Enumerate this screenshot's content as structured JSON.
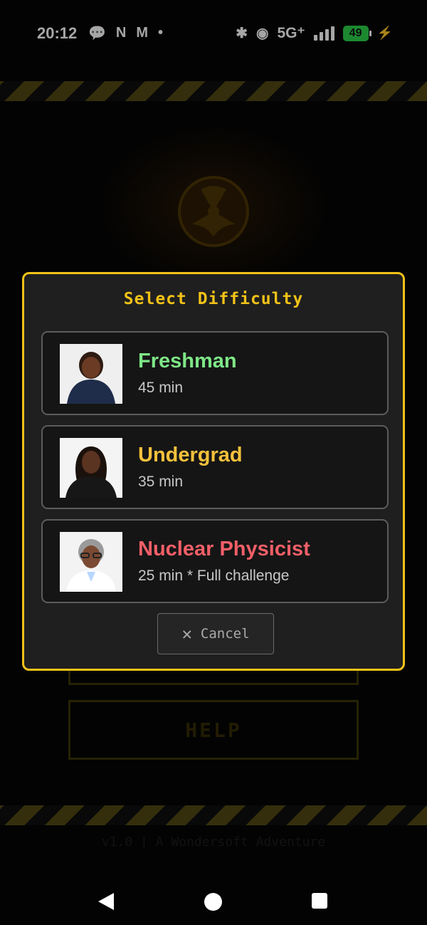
{
  "status": {
    "time": "20:12",
    "network": "5G⁺",
    "battery": "49",
    "left_icons": [
      "chat-icon",
      "n-app-icon",
      "gmail-icon",
      "dot-icon"
    ],
    "right_icons": [
      "bluetooth-icon",
      "hotspot-icon",
      "signal-icon",
      "battery-icon",
      "charging-icon"
    ]
  },
  "background": {
    "help_label": "HELP",
    "footer": "v1.0 | A Wondersoft Adventure",
    "accent_color": "#f2c218"
  },
  "modal": {
    "title": "Select Difficulty",
    "options": [
      {
        "title": "Freshman",
        "subtitle": "45 min",
        "color": "#7ee787",
        "avatar": "freshman-avatar"
      },
      {
        "title": "Undergrad",
        "subtitle": "35 min",
        "color": "#f6c13b",
        "avatar": "undergrad-avatar"
      },
      {
        "title": "Nuclear Physicist",
        "subtitle": "25 min * Full challenge",
        "color": "#f25f68",
        "avatar": "physicist-avatar"
      }
    ],
    "cancel_label": "Cancel"
  }
}
